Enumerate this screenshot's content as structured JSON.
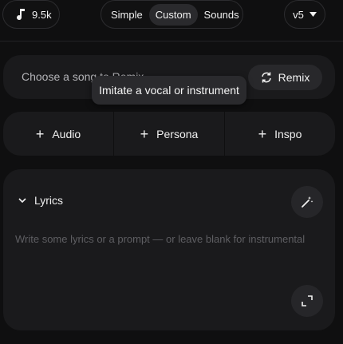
{
  "topbar": {
    "credits": "9.5k",
    "modes": [
      "Simple",
      "Custom",
      "Sounds"
    ],
    "active_mode": "Custom",
    "version": "v5"
  },
  "remix": {
    "placeholder": "Choose a song to Remix",
    "button_label": "Remix",
    "tooltip": "Imitate a vocal or instrument"
  },
  "add_buttons": [
    "Audio",
    "Persona",
    "Inspo"
  ],
  "lyrics": {
    "title": "Lyrics",
    "placeholder": "Write some lyrics or a prompt — or leave blank for instrumental"
  },
  "icons": {
    "credits": "music-note-icon",
    "version": "chevron-down-icon",
    "remix": "refresh-icon",
    "lyrics_toggle": "chevron-down-icon",
    "generate": "magic-wand-icon",
    "expand": "expand-icon"
  }
}
